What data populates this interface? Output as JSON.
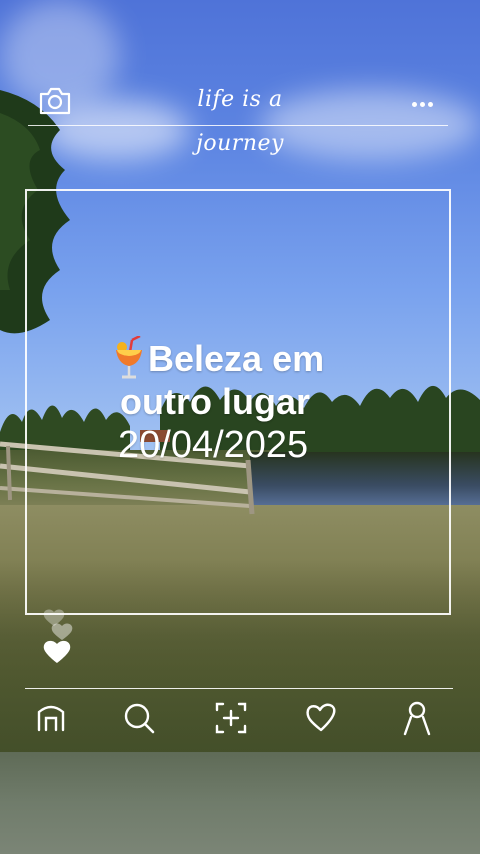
{
  "header": {
    "title": "life is a journey",
    "camera_icon": "camera-icon",
    "more_icon": "more-dots-icon"
  },
  "caption": {
    "line1": "Beleza em",
    "line2": "outro lugar",
    "date": "20/04/2025",
    "emoji_icon": "tropical-drink-icon"
  },
  "nav": {
    "items": [
      {
        "icon": "home-icon"
      },
      {
        "icon": "search-icon"
      },
      {
        "icon": "add-photo-icon"
      },
      {
        "icon": "heart-icon"
      },
      {
        "icon": "profile-icon"
      }
    ]
  },
  "colors": {
    "overlay": "#ffffff",
    "sky": "#5d85e2",
    "grass": "#7a7a4d"
  }
}
